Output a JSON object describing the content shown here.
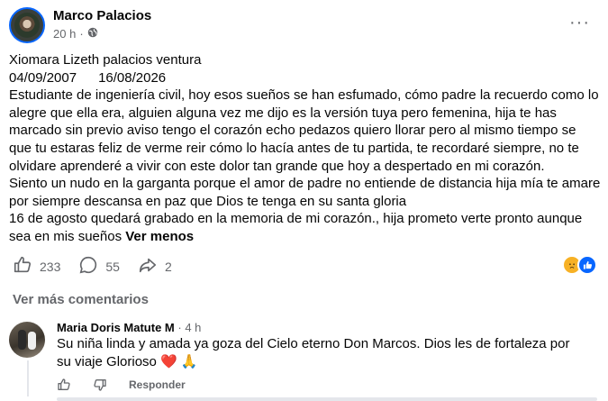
{
  "post": {
    "author": "Marco Palacios",
    "time": "20 h",
    "separator": "·",
    "more": "···",
    "lines": {
      "title": "Xiomara Lizeth palacios ventura",
      "date_birth": "04/09/2007",
      "date_death": "16/08/2026",
      "l1": "Estudiante de ingeniería civil, hoy esos sueños se han esfumado, cómo padre la recuerdo como lo",
      "l2": "alegre que ella era, alguien alguna vez me dijo es la versión tuya pero femenina, hija te has",
      "l3": "marcado sin previo aviso tengo el corazón echo pedazos quiero llorar pero al mismo tiempo se",
      "l4": "que tu estaras feliz de verme reir cómo lo hacía antes de tu partida, te recordaré siempre, no te",
      "l5": "olvidare aprenderé a vivir con este dolor tan grande que hoy a despertado en mi corazón.",
      "l6": "Siento un nudo en la garganta porque el amor de padre no entiende de distancia hija mía te amare",
      "l7": "por siempre descansa en paz que Dios te tenga en su santa gloria",
      "l8": "16 de agosto quedará grabado en la memoria de mi corazón., hija prometo verte pronto aunque",
      "l9": "sea en mis sueños",
      "see_less": "Ver menos"
    },
    "stats": {
      "likes": "233",
      "comments": "55",
      "shares": "2"
    }
  },
  "comments_section": {
    "view_more": "Ver más comentarios",
    "comment": {
      "author": "Maria Doris Matute M",
      "time": "4 h",
      "text_l1": "Su niña linda y amada ya goza del Cielo eterno Don Marcos. Dios les de fortaleza por",
      "text_l2": "su viaje Glorioso",
      "emojis": "❤️ 🙏",
      "reply": "Responder"
    }
  },
  "colors": {
    "text": "#050505",
    "secondary": "#65676b",
    "facebook_blue": "#0866ff",
    "like_blue": "#0866ff",
    "sad_yellow": "#f7b125"
  },
  "icons": [
    "globe-icon",
    "more-icon",
    "like-icon",
    "comment-icon",
    "share-icon",
    "sad-reaction-icon",
    "like-reaction-icon"
  ]
}
